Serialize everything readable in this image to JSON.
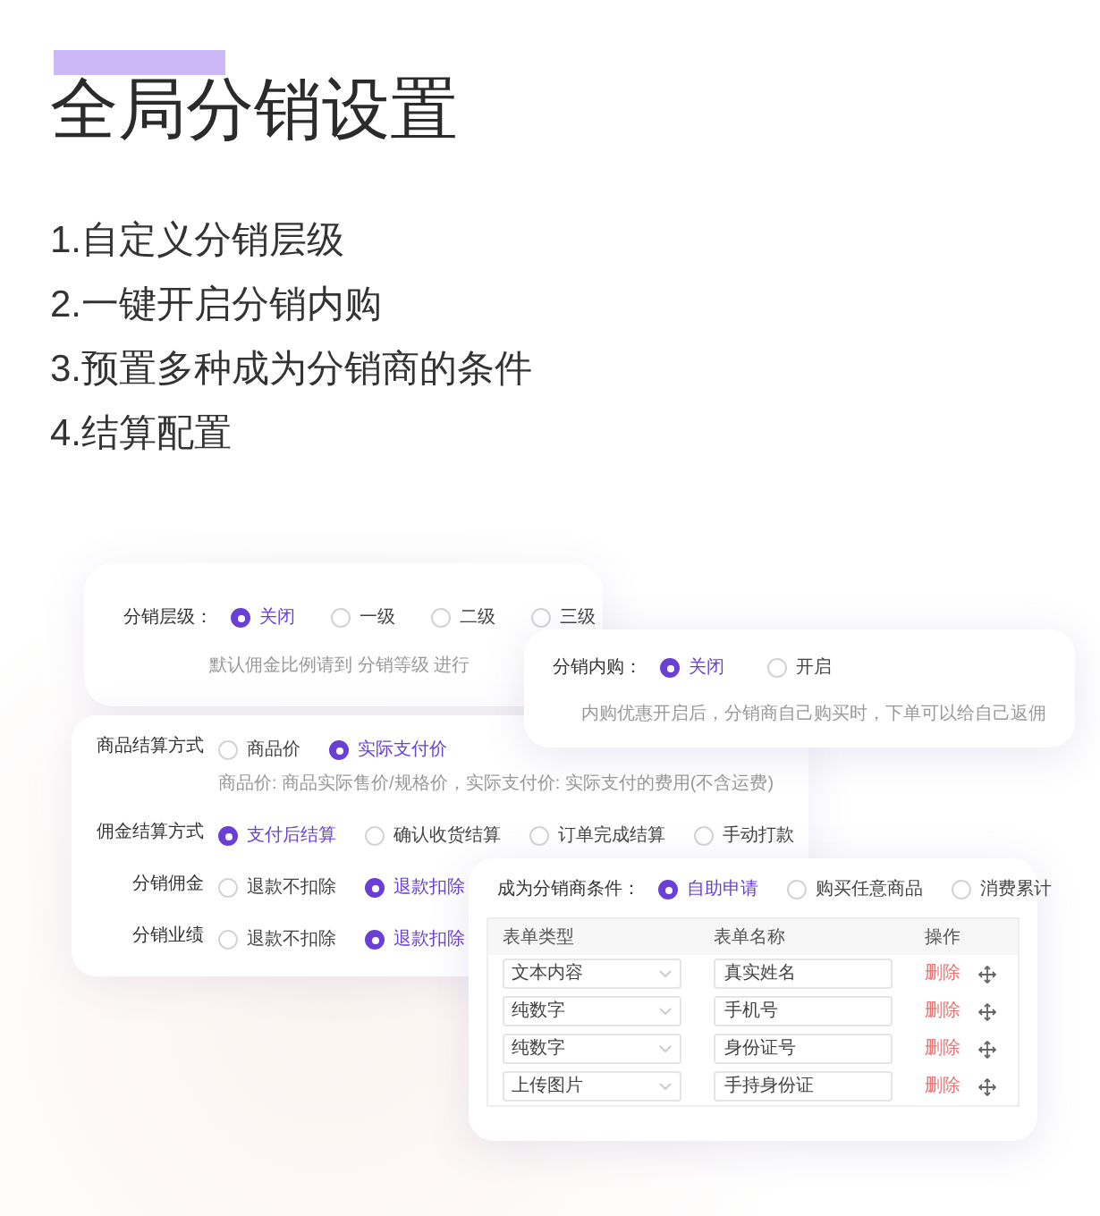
{
  "title": "全局分销设置",
  "features": [
    "1.自定义分销层级",
    "2.一键开启分销内购",
    "3.预置多种成为分销商的条件",
    "4.结算配置"
  ],
  "level_card": {
    "label": "分销层级：",
    "options": [
      {
        "label": "关闭",
        "selected": true
      },
      {
        "label": "一级",
        "selected": false
      },
      {
        "label": "二级",
        "selected": false
      },
      {
        "label": "三级",
        "selected": false
      }
    ],
    "hint": "默认佣金比例请到 分销等级 进行"
  },
  "self_purchase_card": {
    "label": "分销内购：",
    "options": [
      {
        "label": "关闭",
        "selected": true
      },
      {
        "label": "开启",
        "selected": false
      }
    ],
    "hint": "内购优惠开启后，分销商自己购买时，下单可以给自己返佣"
  },
  "settlement_card": {
    "rows": [
      {
        "label": "商品结算方式",
        "options": [
          {
            "label": "商品价",
            "selected": false
          },
          {
            "label": "实际支付价",
            "selected": true
          }
        ],
        "hint": "商品价: 商品实际售价/规格价，实际支付价: 实际支付的费用(不含运费)"
      },
      {
        "label": "佣金结算方式",
        "options": [
          {
            "label": "支付后结算",
            "selected": true
          },
          {
            "label": "确认收货结算",
            "selected": false
          },
          {
            "label": "订单完成结算",
            "selected": false
          },
          {
            "label": "手动打款",
            "selected": false
          }
        ]
      },
      {
        "label": "分销佣金",
        "options": [
          {
            "label": "退款不扣除",
            "selected": false
          },
          {
            "label": "退款扣除",
            "selected": true
          }
        ]
      },
      {
        "label": "分销业绩",
        "options": [
          {
            "label": "退款不扣除",
            "selected": false
          },
          {
            "label": "退款扣除",
            "selected": true
          }
        ]
      }
    ]
  },
  "condition_card": {
    "label": "成为分销商条件：",
    "options": [
      {
        "label": "自助申请",
        "selected": true
      },
      {
        "label": "购买任意商品",
        "selected": false
      },
      {
        "label": "消费累计",
        "selected": false
      }
    ],
    "table": {
      "columns": [
        "表单类型",
        "表单名称",
        "操作"
      ],
      "rows": [
        {
          "type": "文本内容",
          "name": "真实姓名",
          "action": "删除"
        },
        {
          "type": "纯数字",
          "name": "手机号",
          "action": "删除"
        },
        {
          "type": "纯数字",
          "name": "身份证号",
          "action": "删除"
        },
        {
          "type": "上传图片",
          "name": "手持身份证",
          "action": "删除"
        }
      ]
    }
  }
}
